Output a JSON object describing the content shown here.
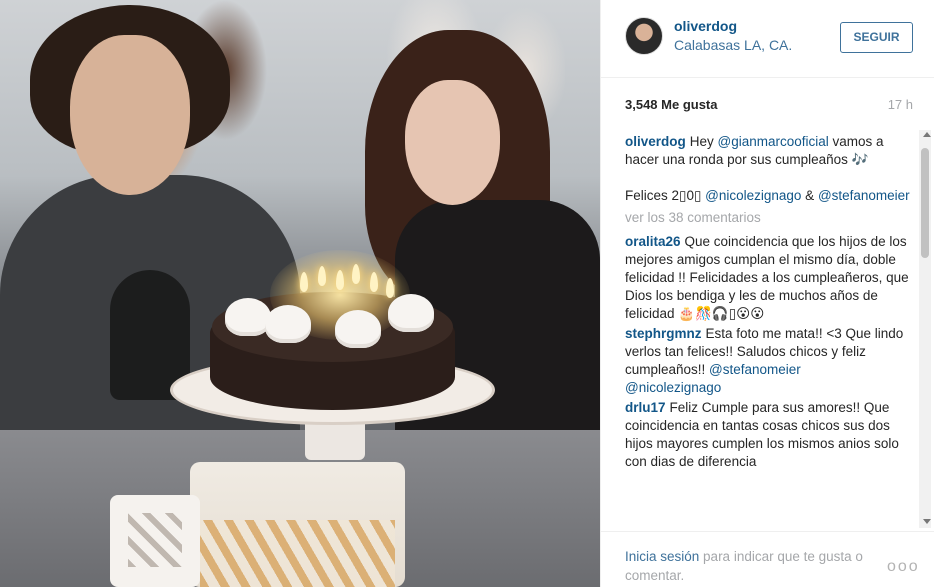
{
  "post": {
    "username": "oliverdog",
    "location": "Calabasas LA, CA.",
    "follow_label": "SEGUIR",
    "likes": "3,548 Me gusta",
    "time": "17 h"
  },
  "caption": {
    "user": "oliverdog",
    "text_1": "Hey ",
    "mention_1": "@gianmarcooficial",
    "text_2": " vamos a hacer una ronda por sus cumpleaños 🎶",
    "text_3": "Felices 2▯0▯ ",
    "mention_2": "@nicolezignago",
    "text_4": " & ",
    "mention_3": "@stefanomeier"
  },
  "view_all": "ver los 38 comentarios",
  "comments": [
    {
      "user": "oralita26",
      "text": "Que coincidencia que los hijos de los mejores amigos cumplan el mismo día, doble felicidad !! Felicidades a los cumpleañeros, que Dios los bendiga y les de muchos años de felicidad 🎂🎊🎧▯😮😮"
    },
    {
      "user": "stephrgmnz",
      "text": "Esta foto me mata!! <3 Que lindo verlos tan felices!! Saludos chicos y feliz cumpleaños!! ",
      "mention_a": "@stefanomeier",
      "mention_b": "@nicolezignago"
    },
    {
      "user": "drlu17",
      "text": "Feliz Cumple para sus amores!! Que coincidencia en tantas cosas chicos sus dos hijos mayores cumplen los mismos anios solo con dias de diferencia"
    }
  ],
  "footer": {
    "login": "Inicia sesión",
    "text": " para indicar que te gusta o comentar.",
    "more": "ooo"
  },
  "colors": {
    "link": "#125688",
    "link_light": "#3f729b",
    "muted": "#a5a7aa"
  }
}
